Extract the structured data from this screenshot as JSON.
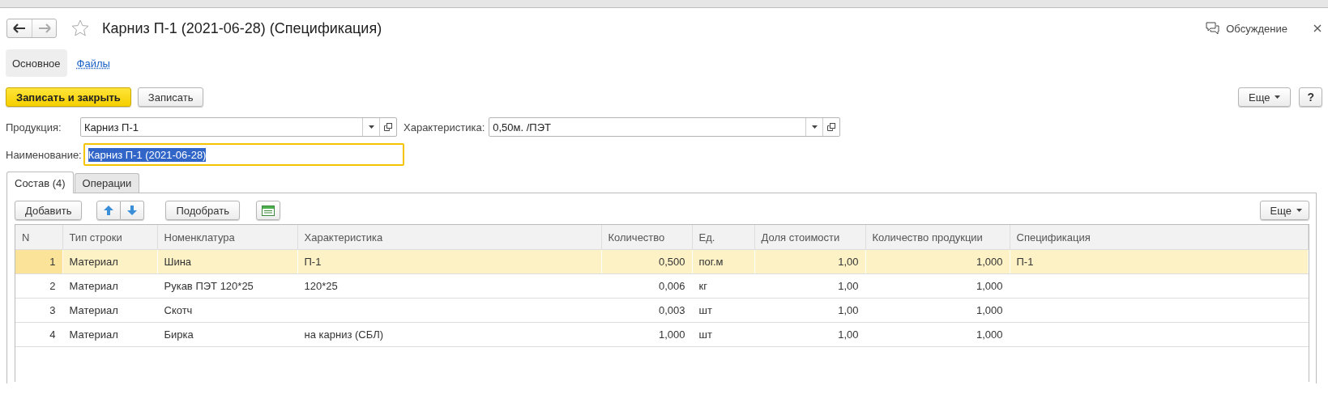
{
  "window": {
    "title": "Карниз П-1 (2021-06-28) (Спецификация)",
    "discussion": "Обсуждение",
    "starred": false
  },
  "sections": [
    {
      "label": "Основное",
      "selected": true
    },
    {
      "label": "Файлы",
      "selected": false
    }
  ],
  "command_bar": {
    "buttons": [
      {
        "label": "Записать и закрыть",
        "kind": "primary"
      },
      {
        "label": "Записать",
        "kind": "plain"
      }
    ],
    "more": "Еще",
    "help": "?"
  },
  "fields": [
    {
      "label": "Продукция:",
      "value": "Карниз П-1",
      "kind": "choice"
    },
    {
      "label": "Характеристика:",
      "value": "0,50м. /ПЭТ",
      "kind": "choice"
    },
    {
      "label": "Наименование:",
      "value": "Карниз П-1 (2021-06-28)",
      "kind": "text",
      "focused": true
    }
  ],
  "tabs": [
    {
      "label": "Состав (4)",
      "selected": true
    },
    {
      "label": "Операции",
      "selected": false
    }
  ],
  "table_toolbar": {
    "add": "Добавить",
    "pick": "Подобрать",
    "more": "Еще"
  },
  "table": {
    "columns": [
      {
        "label": "N",
        "kind": "number"
      },
      {
        "label": "Тип строки",
        "kind": "text"
      },
      {
        "label": "Номенклатура",
        "kind": "text"
      },
      {
        "label": "Характеристика",
        "kind": "text"
      },
      {
        "label": "Количество",
        "kind": "number"
      },
      {
        "label": "Ед.",
        "kind": "text"
      },
      {
        "label": "Доля стоимости",
        "kind": "number"
      },
      {
        "label": "Количество продукции",
        "kind": "number"
      },
      {
        "label": "Спецификация",
        "kind": "text"
      }
    ],
    "rows": [
      {
        "selected": true,
        "cells": [
          "1",
          "Материал",
          "Шина",
          "П-1",
          "0,500",
          "пог.м",
          "1,00",
          "1,000",
          "П-1"
        ]
      },
      {
        "selected": false,
        "cells": [
          "2",
          "Материал",
          "Рукав ПЭТ 120*25",
          "120*25",
          "0,006",
          "кг",
          "1,00",
          "1,000",
          ""
        ]
      },
      {
        "selected": false,
        "cells": [
          "3",
          "Материал",
          "Скотч",
          "",
          "0,003",
          "шт",
          "1,00",
          "1,000",
          ""
        ]
      },
      {
        "selected": false,
        "cells": [
          "4",
          "Материал",
          "Бирка",
          "на карниз (СБЛ)",
          "1,000",
          "шт",
          "1,00",
          "1,000",
          ""
        ]
      }
    ]
  }
}
